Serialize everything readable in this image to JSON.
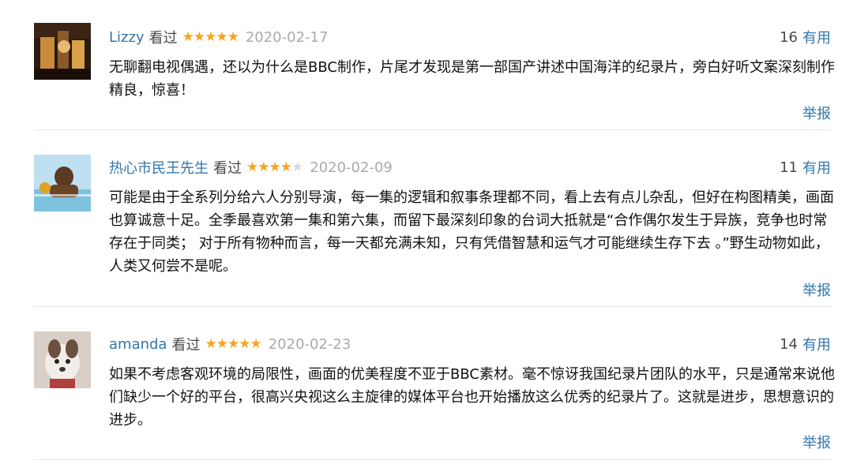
{
  "reviews": [
    {
      "author": "Lizzy",
      "status": "看过",
      "rating": 5,
      "date": "2020-02-17",
      "votes": "16",
      "useful_label": "有用",
      "content": "无聊翻电视偶遇，还以为什么是BBC制作，片尾才发现是第一部国产讲述中国海洋的纪录片，旁白好听文案深刻制作精良，惊喜！",
      "report_label": "举报"
    },
    {
      "author": "热心市民王先生",
      "status": "看过",
      "rating": 4,
      "date": "2020-02-09",
      "votes": "11",
      "useful_label": "有用",
      "content": "可能是由于全系列分给六人分别导演，每一集的逻辑和叙事条理都不同，看上去有点儿杂乱，但好在构图精美，画面也算诚意十足。全季最喜欢第一集和第六集，而留下最深刻印象的台词大抵就是“合作偶尔发生于异族，竞争也时常存在于同类； 对于所有物种而言，每一天都充满未知，只有凭借智慧和运气才可能继续生存下去 。”野生动物如此，人类又何尝不是呢。",
      "report_label": "举报"
    },
    {
      "author": "amanda",
      "status": "看过",
      "rating": 5,
      "date": "2020-02-23",
      "votes": "14",
      "useful_label": "有用",
      "content": "如果不考虑客观环境的局限性，画面的优美程度不亚于BBC素材。毫不惊讶我国纪录片团队的水平，只是通常来说他们缺少一个好的平台，很高兴央视这么主旋律的媒体平台也开始播放这么优秀的纪录片了。这就是进步，思想意识的进步。",
      "report_label": "举报"
    }
  ],
  "colors": {
    "link": "#3377aa",
    "star": "#f5a623",
    "star_empty": "#d9d9d9",
    "date": "#aaaaaa",
    "divider": "#e8e8e8"
  }
}
